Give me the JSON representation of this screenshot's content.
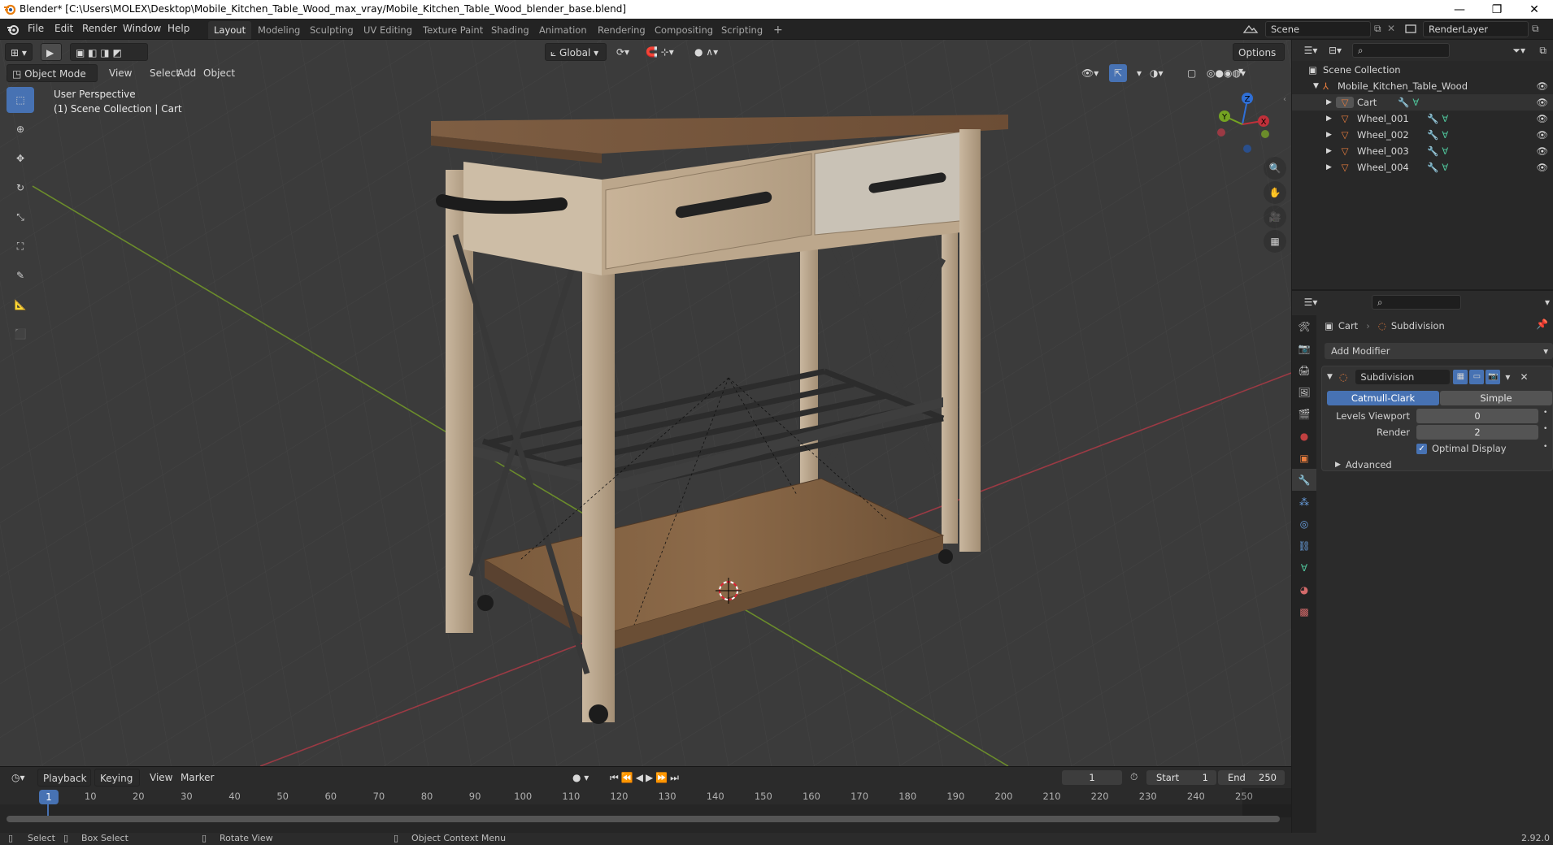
{
  "window": {
    "title": "Blender* [C:\\Users\\MOLEX\\Desktop\\Mobile_Kitchen_Table_Wood_max_vray/Mobile_Kitchen_Table_Wood_blender_base.blend]"
  },
  "menu": {
    "items": [
      "File",
      "Edit",
      "Render",
      "Window",
      "Help"
    ]
  },
  "workspaces": {
    "active": "Layout",
    "tabs": [
      "Layout",
      "Modeling",
      "Sculpting",
      "UV Editing",
      "Texture Paint",
      "Shading",
      "Animation",
      "Rendering",
      "Compositing",
      "Scripting"
    ],
    "add": "+"
  },
  "scene": {
    "name": "Scene",
    "view_layer": "RenderLayer"
  },
  "viewport_header": {
    "mode": "Object Mode",
    "menus": [
      "View",
      "Select",
      "Add",
      "Object"
    ],
    "orientation": "Global",
    "options": "Options"
  },
  "viewport": {
    "perspective": "User Perspective",
    "context": "(1) Scene Collection | Cart",
    "axes": {
      "z": "Z",
      "y": "Y",
      "x": "X"
    }
  },
  "outliner": {
    "root": "Scene Collection",
    "collection": "Mobile_Kitchen_Table_Wood",
    "objects": [
      "Cart",
      "Wheel_001",
      "Wheel_002",
      "Wheel_003",
      "Wheel_004"
    ]
  },
  "properties": {
    "breadcrumb_object": "Cart",
    "breadcrumb_modifier": "Subdivision",
    "add_modifier": "Add Modifier",
    "modifier": {
      "name": "Subdivision",
      "type_a": "Catmull-Clark",
      "type_b": "Simple",
      "levels_viewport_label": "Levels Viewport",
      "levels_viewport": "0",
      "render_label": "Render",
      "render": "2",
      "optimal_display": "Optimal Display",
      "optimal_checked": true,
      "advanced": "Advanced"
    }
  },
  "timeline": {
    "menus": [
      "Playback",
      "Keying",
      "View",
      "Marker"
    ],
    "current_frame": "1",
    "start_label": "Start",
    "start": "1",
    "end_label": "End",
    "end": "250",
    "ticks": [
      "1",
      "10",
      "20",
      "30",
      "40",
      "50",
      "60",
      "70",
      "80",
      "90",
      "100",
      "110",
      "120",
      "130",
      "140",
      "150",
      "160",
      "170",
      "180",
      "190",
      "200",
      "210",
      "220",
      "230",
      "240",
      "250"
    ]
  },
  "statusbar": {
    "select": "Select",
    "box_select": "Box Select",
    "rotate": "Rotate View",
    "context_menu": "Object Context Menu",
    "version": "2.92.0"
  },
  "colors": {
    "accent": "#4772b3",
    "x_axis": "#c0303a",
    "y_axis": "#74a322",
    "z_axis": "#2f6fd6",
    "object_orange": "#e87d3e"
  }
}
